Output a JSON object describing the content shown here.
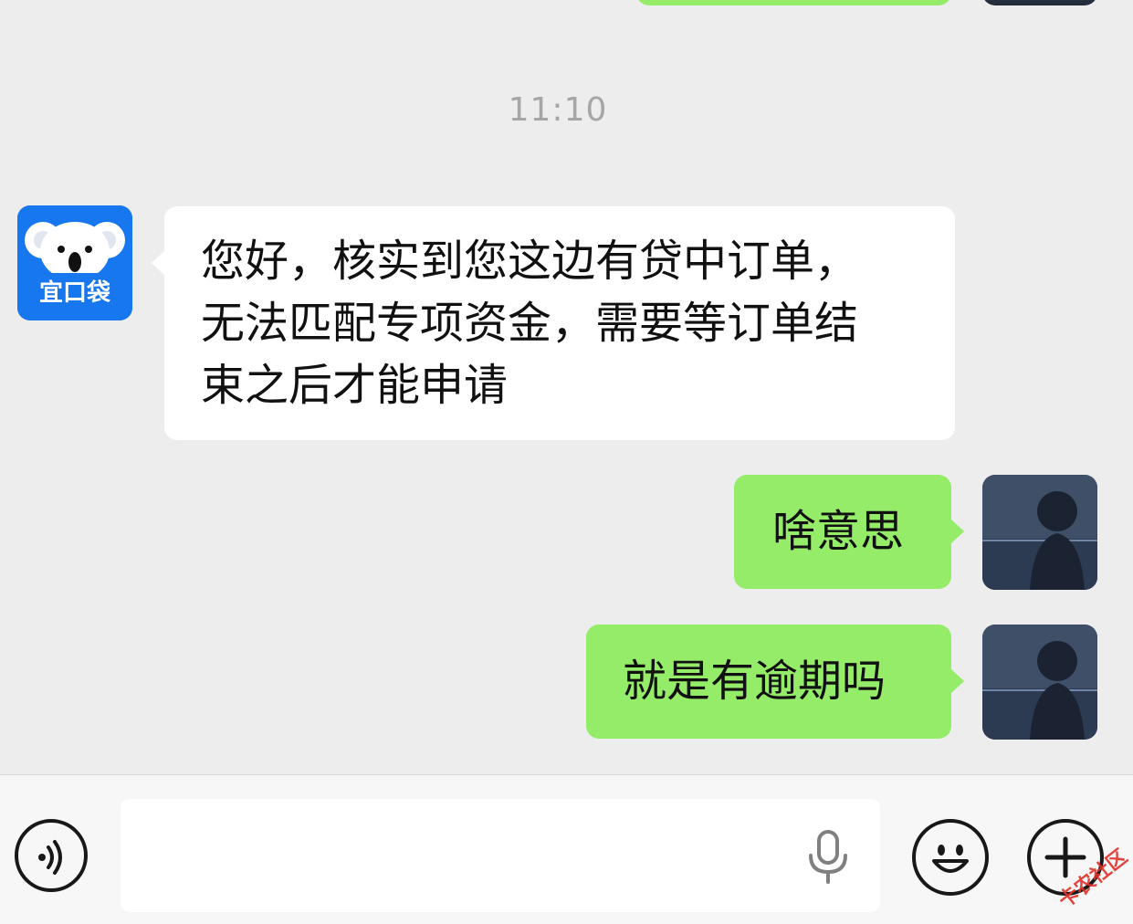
{
  "chat": {
    "timestamp": "11:10",
    "messages": [
      {
        "sender": "other",
        "lines": [
          "您好，核实到您这边有贷中订单，",
          "无法匹配专项资金，需要等订单结",
          "束之后才能申请"
        ]
      },
      {
        "sender": "self",
        "text": "啥意思"
      },
      {
        "sender": "self",
        "text": "就是有逾期吗"
      }
    ],
    "bot_avatar": {
      "logo_text": "宜口袋",
      "icon": "koala-icon",
      "color": "#1677ee"
    }
  },
  "input_bar": {
    "voice_icon": "voice-mode-icon",
    "mic_icon": "microphone-icon",
    "emoji_icon": "emoji-icon",
    "plus_icon": "plus-icon",
    "input_value": ""
  },
  "watermark": {
    "text": "卡农社区"
  },
  "colors": {
    "background": "#ededed",
    "self_bubble": "#95ec69",
    "other_bubble": "#ffffff",
    "timestamp": "#a6a6a6"
  }
}
